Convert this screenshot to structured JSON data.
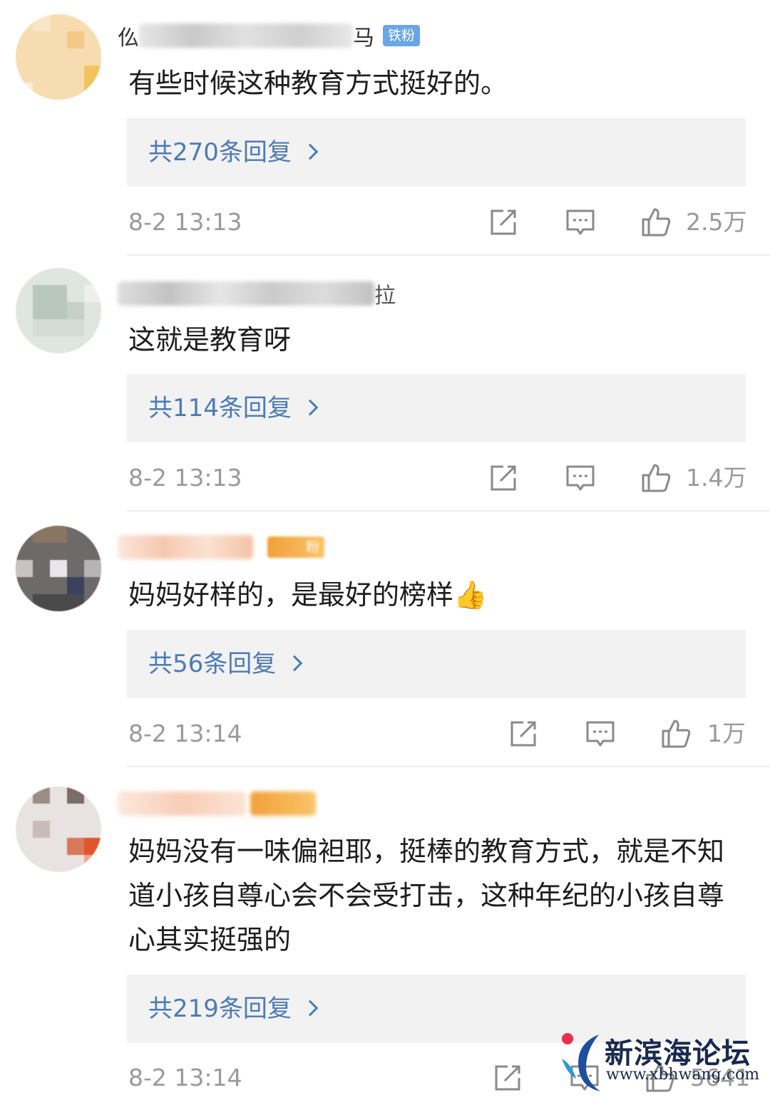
{
  "comments": [
    {
      "name_prefix": "仫",
      "name_suffix": "马",
      "badge": "铁粉",
      "text": "有些时候这种教育方式挺好的。",
      "reply_label": "共270条回复",
      "time": "8-2 13:13",
      "likes": "2.5万"
    },
    {
      "name_suffix": "拉",
      "text": "这就是教育呀",
      "reply_label": "共114条回复",
      "time": "8-2 13:13",
      "likes": "1.4万"
    },
    {
      "badge": "粉",
      "text": "妈妈好样的，是最好的榜样👍",
      "reply_label": "共56条回复",
      "time": "8-2 13:14",
      "likes": "1万"
    },
    {
      "text": "妈妈没有一味偏袒耶，挺棒的教育方式，就是不知道小孩自尊心会不会受打击，这种年纪的小孩自尊心其实挺强的",
      "reply_label": "共219条回复",
      "time": "8-2 13:14",
      "likes": "5641"
    }
  ],
  "watermark": {
    "title": "新滨海论坛",
    "url": "www.xbhwang.com"
  },
  "icons": [
    "share-icon",
    "comment-icon",
    "like-icon"
  ],
  "colors": {
    "link": "#4b7bb5",
    "meta": "#9a9a9a",
    "reply_bg": "#f2f2f2",
    "badge_blue": "#6aa6e8"
  }
}
